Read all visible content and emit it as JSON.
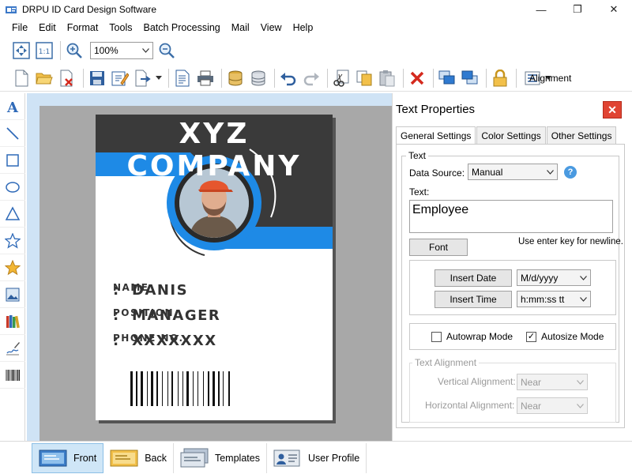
{
  "window": {
    "title": "DRPU ID Card Design Software",
    "minimize_glyph": "—",
    "maximize_glyph": "❐",
    "close_glyph": "✕"
  },
  "menu": [
    "File",
    "Edit",
    "Format",
    "Tools",
    "Batch Processing",
    "Mail",
    "View",
    "Help"
  ],
  "toolbar": {
    "zoom_value": "100%",
    "alignment_label": "Alignment"
  },
  "card": {
    "company": "XYZ COMPANY",
    "fields": [
      {
        "label": "NAME",
        "value": "DANIS"
      },
      {
        "label": "POSITION",
        "value": "MANAGER"
      },
      {
        "label": "PHONE NO.",
        "value": "XXXXXXX"
      }
    ],
    "colon": ":",
    "accent_color": "#1e8ae6",
    "header_color": "#3a3a3a"
  },
  "panel": {
    "title": "Text Properties",
    "close_glyph": "✕",
    "tabs": [
      "General Settings",
      "Color Settings",
      "Other Settings"
    ],
    "text_group_label": "Text",
    "data_source_label": "Data Source:",
    "data_source_value": "Manual",
    "help_glyph": "?",
    "text_label": "Text:",
    "text_value": "Employee",
    "font_button": "Font",
    "newline_hint": "Use enter key for newline.",
    "insert_date_button": "Insert Date",
    "date_format": "M/d/yyyy",
    "insert_time_button": "Insert Time",
    "time_format": "h:mm:ss tt",
    "autowrap_label": "Autowrap Mode",
    "autowrap_checked": false,
    "autosize_label": "Autosize Mode",
    "autosize_checked": true,
    "check_glyph": "✓",
    "alignment_group_label": "Text Alignment",
    "vertical_alignment_label": "Vertical Alignment:",
    "vertical_alignment_value": "Near",
    "horizontal_alignment_label": "Horizontal  Alignment:",
    "horizontal_alignment_value": "Near"
  },
  "bottom_tabs": [
    "Front",
    "Back",
    "Templates",
    "User Profile"
  ],
  "colors": {
    "close_red": "#e04433",
    "active_tab_blue": "#cfe6f7"
  }
}
